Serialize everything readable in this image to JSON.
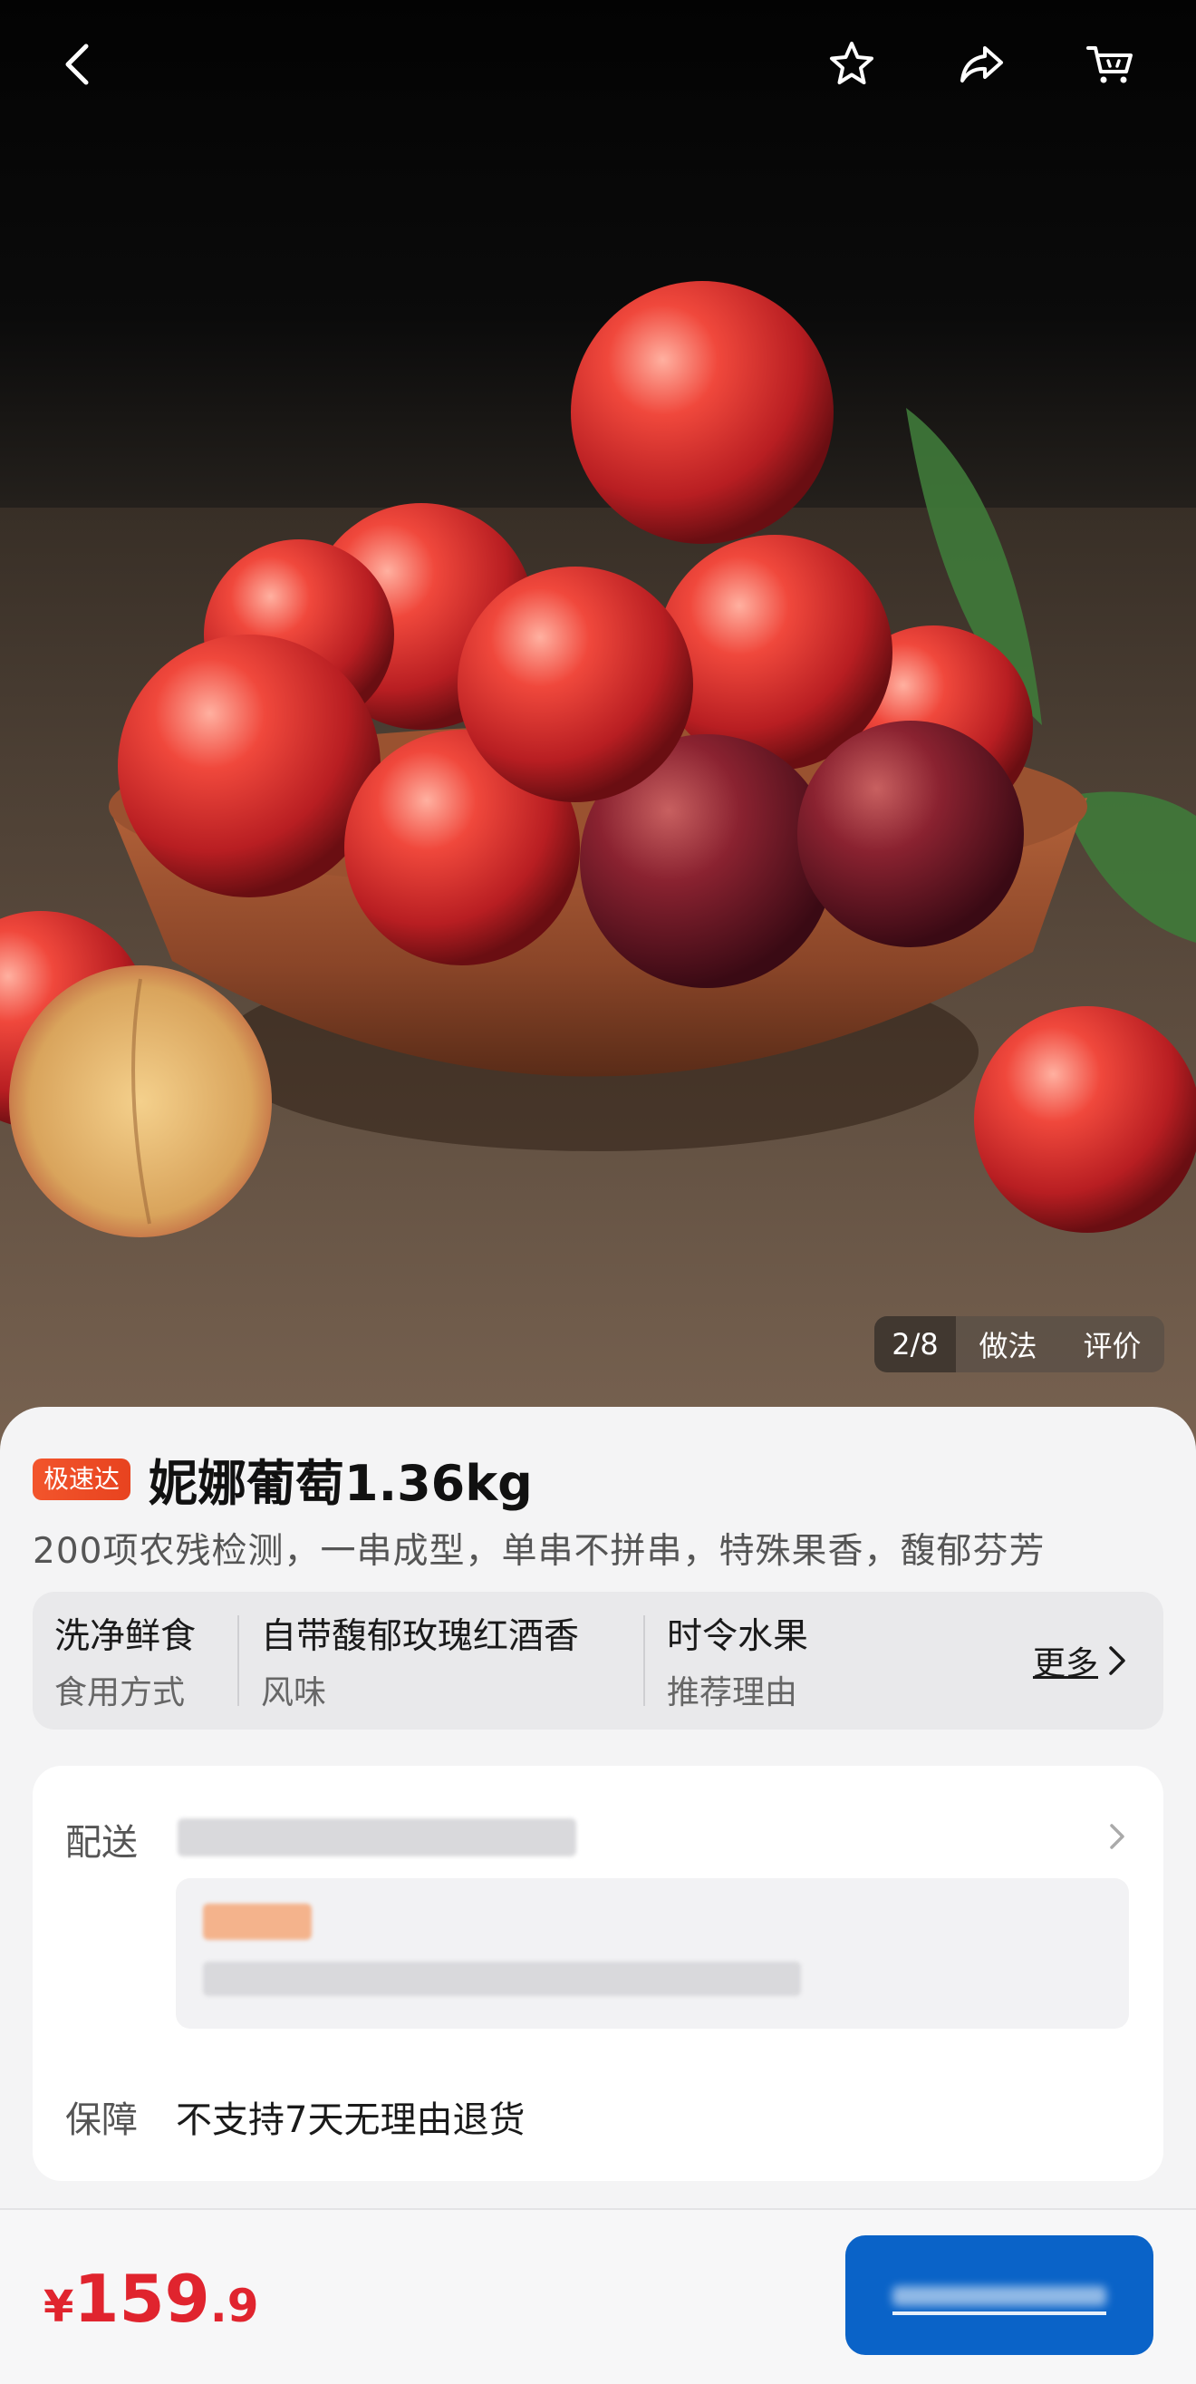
{
  "gallery": {
    "index": "2/8",
    "tabs": [
      "做法",
      "评价"
    ]
  },
  "product": {
    "badge": "极速达",
    "title": "妮娜葡萄1.36kg",
    "subtitle": "200项农残检测，一串成型，单串不拼串，特殊果香，馥郁芬芳",
    "attributes": [
      {
        "value": "洗净鲜食",
        "key": "食用方式"
      },
      {
        "value": "自带馥郁玫瑰红酒香",
        "key": "风味"
      },
      {
        "value": "时令水果",
        "key": "推荐理由"
      }
    ],
    "more_label": "更多"
  },
  "service": {
    "delivery_label": "配送",
    "guarantee_label": "保障",
    "guarantee_text": "不支持7天无理由退货"
  },
  "bottom": {
    "currency": "¥",
    "price_int": "159",
    "price_dec": ".9"
  },
  "colors": {
    "accent": "#0a63c8",
    "price": "#e0242e",
    "badge": "#e8431f"
  }
}
